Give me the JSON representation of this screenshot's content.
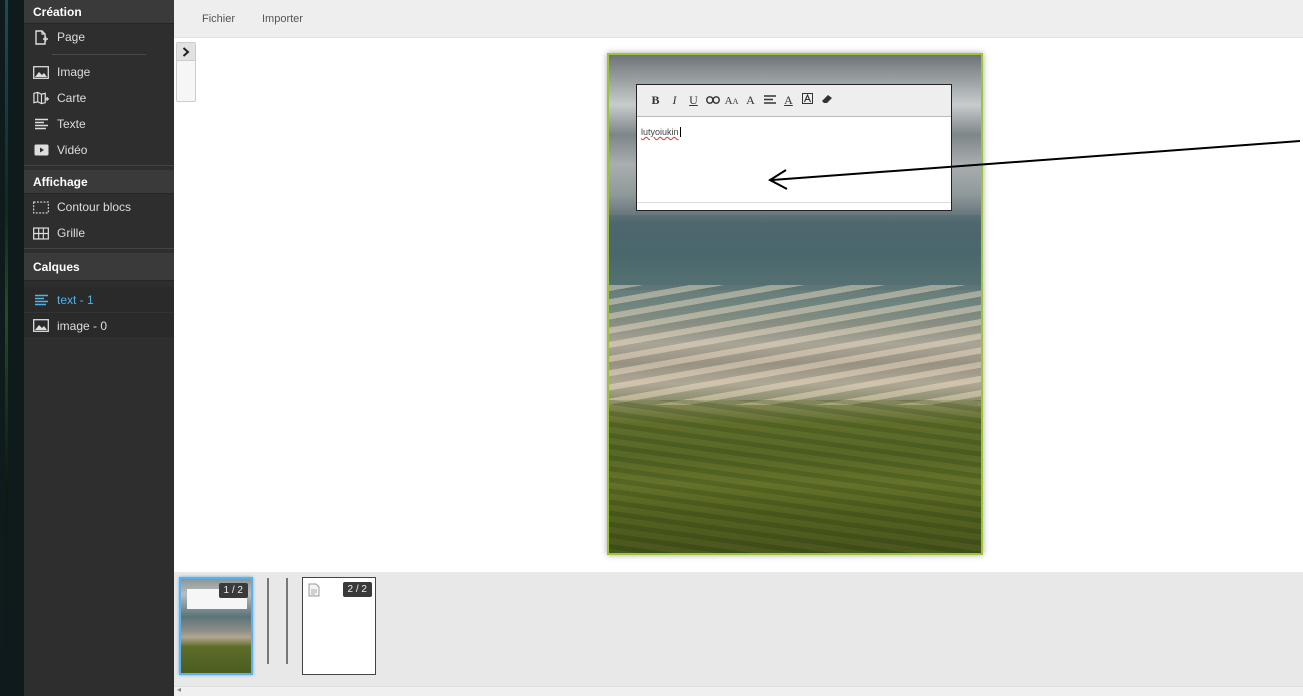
{
  "menubar": {
    "file": "Fichier",
    "import": "Importer"
  },
  "sidebar": {
    "creation": {
      "title": "Création",
      "items": [
        {
          "label": "Page",
          "icon": "add-page-icon"
        },
        {
          "label": "Image",
          "icon": "image-icon"
        },
        {
          "label": "Carte",
          "icon": "map-icon"
        },
        {
          "label": "Texte",
          "icon": "text-lines-icon"
        },
        {
          "label": "Vidéo",
          "icon": "video-icon"
        }
      ]
    },
    "display": {
      "title": "Affichage",
      "items": [
        {
          "label": "Contour blocs",
          "icon": "dashed-outline-icon"
        },
        {
          "label": "Grille",
          "icon": "grid-icon"
        }
      ]
    },
    "layers": {
      "title": "Calques",
      "items": [
        {
          "label": "text - 1",
          "icon": "text-lines-icon",
          "active": true
        },
        {
          "label": "image - 0",
          "icon": "image-icon",
          "active": false
        }
      ]
    }
  },
  "editor": {
    "toolbar": [
      "B",
      "I",
      "U",
      "link",
      "font-size",
      "font-style",
      "align",
      "text-color",
      "background-color",
      "clear-format"
    ],
    "text": "lutyoiukin"
  },
  "thumbnails": [
    {
      "badge": "1 / 2",
      "selected": true
    },
    {
      "badge": "2 / 2",
      "selected": false
    }
  ],
  "colors": {
    "accent": "#4fb3e8",
    "page_border": "#9dc33b",
    "sidebar_bg": "#2e2e2e"
  }
}
